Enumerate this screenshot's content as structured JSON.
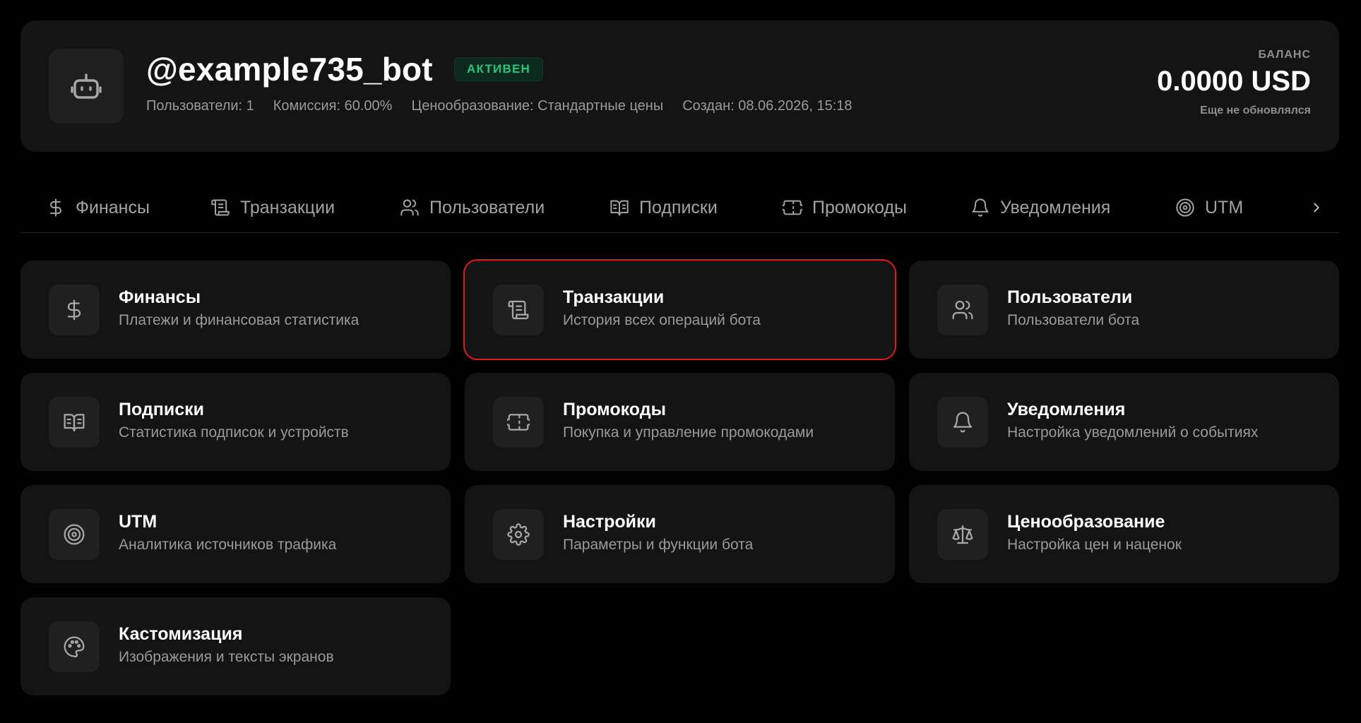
{
  "bot": {
    "username": "@example735_bot",
    "status": "АКТИВЕН",
    "meta": {
      "users": "Пользователи: 1",
      "commission": "Комиссия: 60.00%",
      "pricing": "Ценообразование: Стандартные цены",
      "created": "Создан: 08.06.2026, 15:18"
    }
  },
  "balance": {
    "label": "БАЛАНС",
    "value": "0.0000 USD",
    "updated": "Еще не обновлялся"
  },
  "tabs": [
    {
      "label": "Финансы",
      "icon": "dollar-icon"
    },
    {
      "label": "Транзакции",
      "icon": "scroll-icon"
    },
    {
      "label": "Пользователи",
      "icon": "users-icon"
    },
    {
      "label": "Подписки",
      "icon": "book-icon"
    },
    {
      "label": "Промокоды",
      "icon": "ticket-icon"
    },
    {
      "label": "Уведомления",
      "icon": "bell-icon"
    },
    {
      "label": "UTM",
      "icon": "target-icon"
    }
  ],
  "cards": [
    {
      "title": "Финансы",
      "desc": "Платежи и финансовая статистика",
      "icon": "dollar-icon"
    },
    {
      "title": "Транзакции",
      "desc": "История всех операций бота",
      "icon": "scroll-icon",
      "selected": true
    },
    {
      "title": "Пользователи",
      "desc": "Пользователи бота",
      "icon": "users-icon"
    },
    {
      "title": "Подписки",
      "desc": "Статистика подписок и устройств",
      "icon": "book-icon"
    },
    {
      "title": "Промокоды",
      "desc": "Покупка и управление промокодами",
      "icon": "ticket-icon"
    },
    {
      "title": "Уведомления",
      "desc": "Настройка уведомлений о событиях",
      "icon": "bell-icon"
    },
    {
      "title": "UTM",
      "desc": "Аналитика источников трафика",
      "icon": "target-icon"
    },
    {
      "title": "Настройки",
      "desc": "Параметры и функции бота",
      "icon": "gear-icon"
    },
    {
      "title": "Ценообразование",
      "desc": "Настройка цен и наценок",
      "icon": "scale-icon"
    },
    {
      "title": "Кастомизация",
      "desc": "Изображения и тексты экранов",
      "icon": "palette-icon"
    }
  ],
  "colors": {
    "background": "#000000",
    "card": "#141414",
    "status_green": "#22c77e",
    "selection_outline": "#e01b1b"
  }
}
